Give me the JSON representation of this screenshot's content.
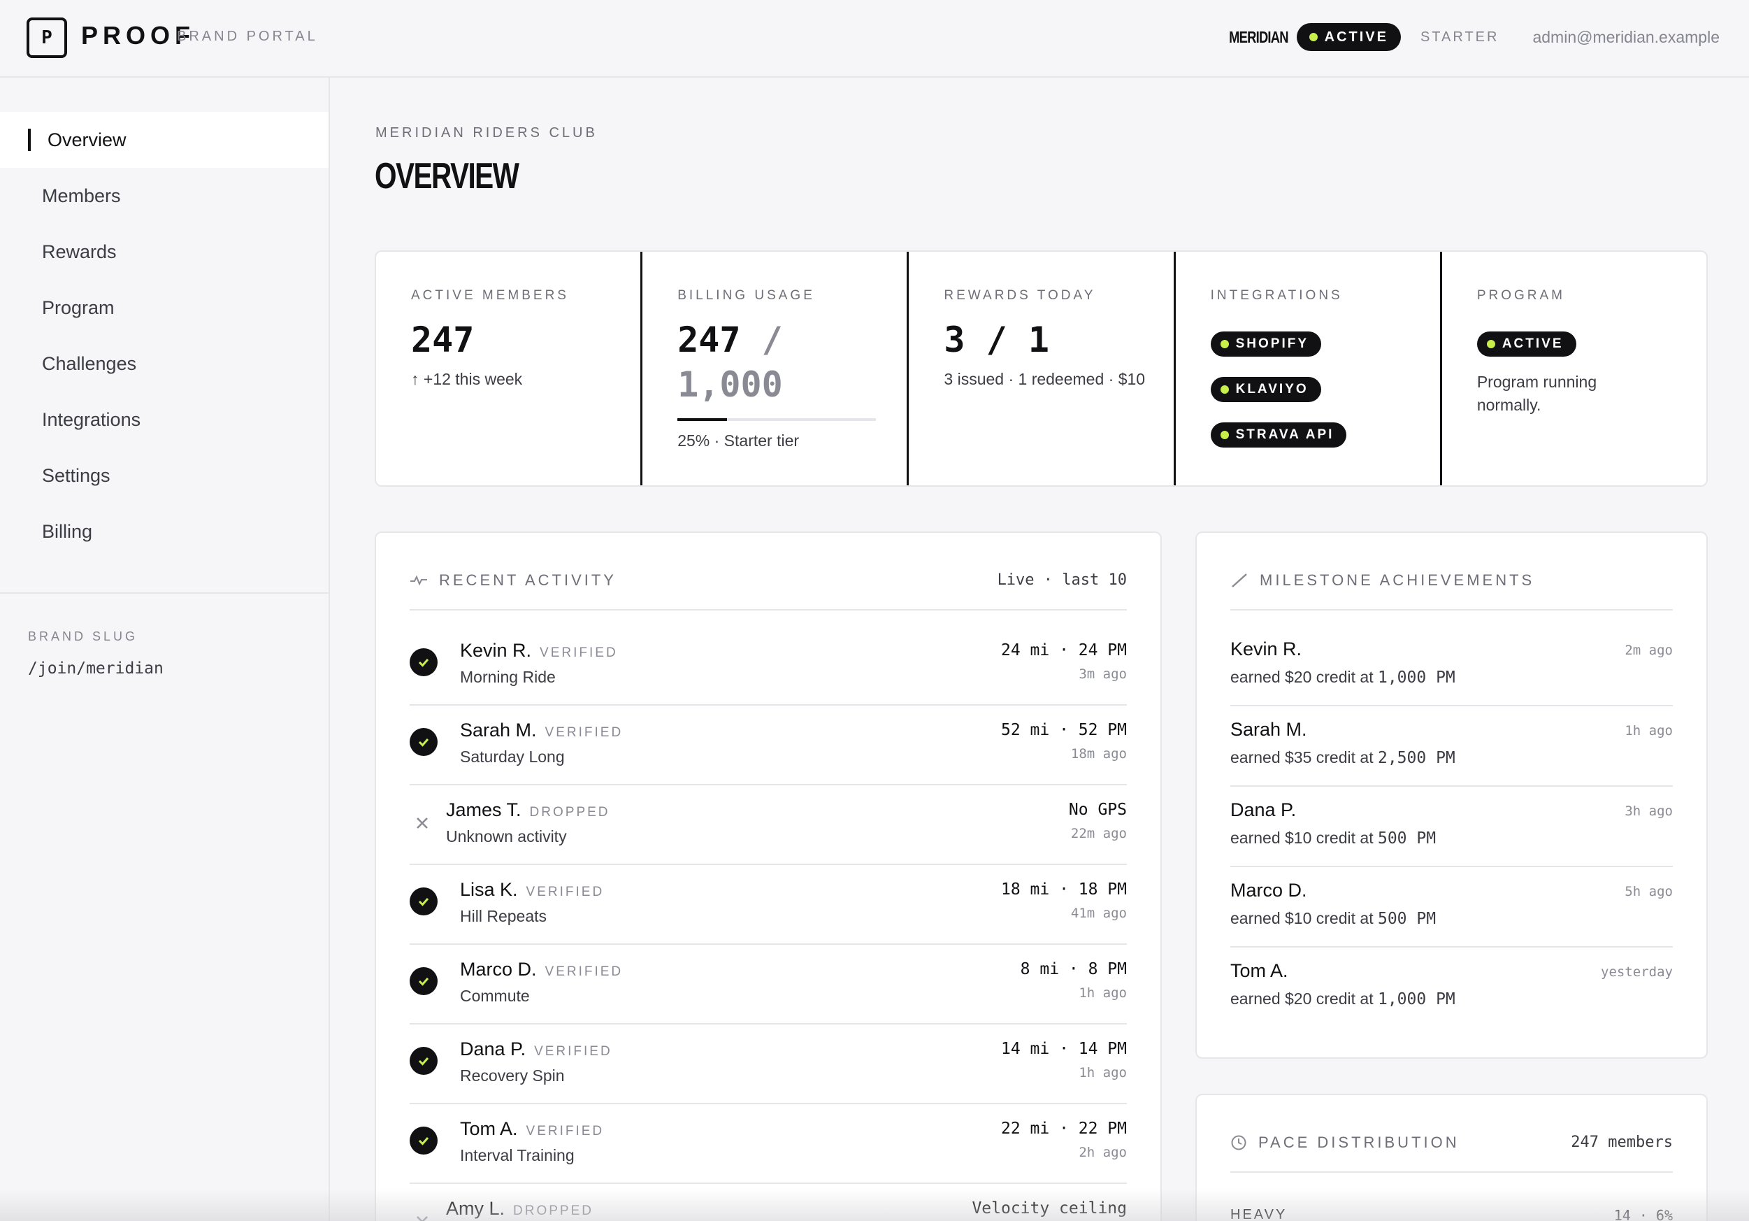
{
  "header": {
    "logo_letter": "P",
    "logo_word": "PROOF",
    "portal_label": "BRAND PORTAL",
    "brand_name": "MERIDIAN",
    "status": "ACTIVE",
    "plan": "STARTER",
    "user_email": "admin@meridian.example"
  },
  "sidebar": {
    "items": [
      {
        "label": "Overview",
        "active": true
      },
      {
        "label": "Members"
      },
      {
        "label": "Rewards"
      },
      {
        "label": "Program"
      },
      {
        "label": "Challenges"
      },
      {
        "label": "Integrations"
      },
      {
        "label": "Settings"
      },
      {
        "label": "Billing"
      }
    ],
    "slug_label": "BRAND SLUG",
    "slug_value": "/join/meridian"
  },
  "main": {
    "eyebrow": "MERIDIAN RIDERS CLUB",
    "title": "OVERVIEW"
  },
  "stats": {
    "active_members": {
      "label": "ACTIVE MEMBERS",
      "value": "247",
      "delta": "↑ +12 this week"
    },
    "billing": {
      "label": "BILLING USAGE",
      "used": "247",
      "separator": "/",
      "limit": "1,000",
      "percent": 25,
      "note": "25% · Starter tier"
    },
    "rewards": {
      "label": "REWARDS TODAY",
      "value": "3 / 1",
      "note": "3 issued · 1 redeemed · $10"
    },
    "integrations": {
      "label": "INTEGRATIONS",
      "items": [
        "SHOPIFY",
        "KLAVIYO",
        "STRAVA API"
      ]
    },
    "program": {
      "label": "PROGRAM",
      "status": "ACTIVE",
      "note": "Program running normally."
    }
  },
  "activity": {
    "title": "RECENT ACTIVITY",
    "meta": "Live · last 10",
    "rows": [
      {
        "name": "Kevin R.",
        "status": "VERIFIED",
        "title": "Morning Ride",
        "value": "24 mi · 24 PM",
        "time": "3m ago"
      },
      {
        "name": "Sarah M.",
        "status": "VERIFIED",
        "title": "Saturday Long",
        "value": "52 mi · 52 PM",
        "time": "18m ago"
      },
      {
        "name": "James T.",
        "status": "DROPPED",
        "title": "Unknown activity",
        "value": "No GPS",
        "time": "22m ago"
      },
      {
        "name": "Lisa K.",
        "status": "VERIFIED",
        "title": "Hill Repeats",
        "value": "18 mi · 18 PM",
        "time": "41m ago"
      },
      {
        "name": "Marco D.",
        "status": "VERIFIED",
        "title": "Commute",
        "value": "8 mi · 8 PM",
        "time": "1h ago"
      },
      {
        "name": "Dana P.",
        "status": "VERIFIED",
        "title": "Recovery Spin",
        "value": "14 mi · 14 PM",
        "time": "1h ago"
      },
      {
        "name": "Tom A.",
        "status": "VERIFIED",
        "title": "Interval Training",
        "value": "22 mi · 22 PM",
        "time": "2h ago"
      },
      {
        "name": "Amy L.",
        "status": "DROPPED",
        "title": "",
        "value": "Velocity ceiling",
        "time": ""
      }
    ]
  },
  "milestones": {
    "title": "MILESTONE ACHIEVEMENTS",
    "rows": [
      {
        "name": "Kevin R.",
        "desc_prefix": "earned $20 credit at ",
        "desc_value": "1,000 PM",
        "time": "2m ago"
      },
      {
        "name": "Sarah M.",
        "desc_prefix": "earned $35 credit at ",
        "desc_value": "2,500 PM",
        "time": "1h ago"
      },
      {
        "name": "Dana P.",
        "desc_prefix": "earned $10 credit at ",
        "desc_value": "500 PM",
        "time": "3h ago"
      },
      {
        "name": "Marco D.",
        "desc_prefix": "earned $10 credit at ",
        "desc_value": "500 PM",
        "time": "5h ago"
      },
      {
        "name": "Tom A.",
        "desc_prefix": "earned $20 credit at ",
        "desc_value": "1,000 PM",
        "time": "yesterday"
      }
    ]
  },
  "pace": {
    "title": "PACE DISTRIBUTION",
    "meta": "247 members",
    "rows": [
      {
        "label": "HEAVY",
        "value": "14 · 6%"
      }
    ]
  }
}
